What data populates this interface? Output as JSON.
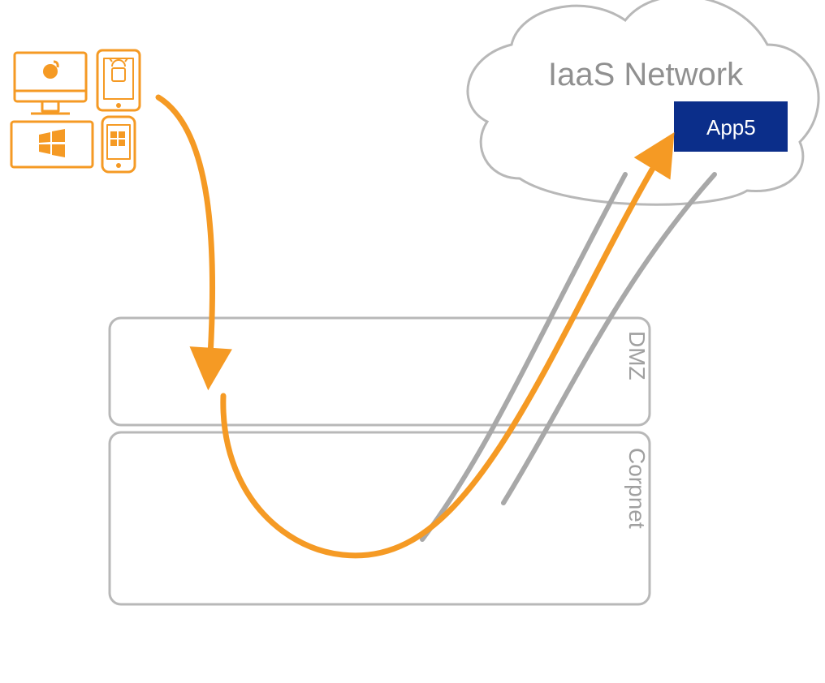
{
  "cloud": {
    "label": "IaaS  Network"
  },
  "app": {
    "label": "App5",
    "fill": "#0b2e8a"
  },
  "zones": {
    "dmz": "DMZ",
    "corp": "Corpnet"
  },
  "colors": {
    "orange": "#f59a24",
    "grey": "#a8a8a8",
    "cloudLine": "#b8b8b8",
    "zoneLine": "#b8b8b8"
  }
}
